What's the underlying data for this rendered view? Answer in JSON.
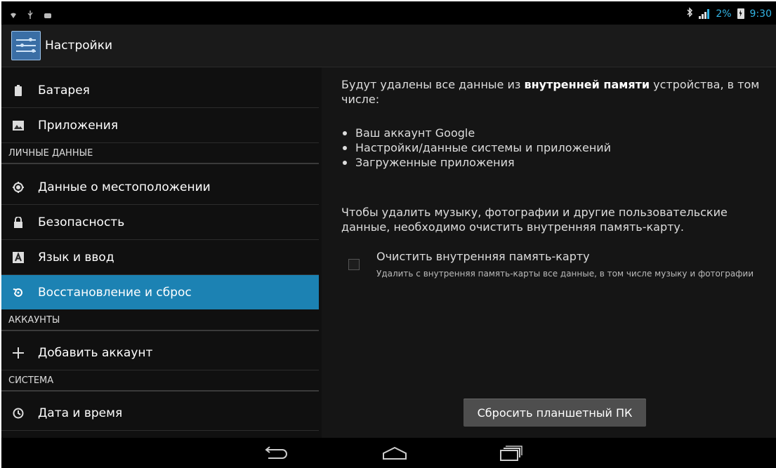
{
  "status_bar": {
    "battery_percent": "2%",
    "time": "9:30",
    "icons": [
      "wifi-icon",
      "usb-icon",
      "android-debug-icon",
      "bluetooth-icon",
      "signal-icon",
      "battery-charging-icon"
    ]
  },
  "action_bar": {
    "title": "Настройки",
    "icon": "settings-sliders-icon"
  },
  "sidebar": {
    "items": [
      {
        "label": "Батарея",
        "icon": "battery-icon"
      },
      {
        "label": "Приложения",
        "icon": "apps-image-icon"
      },
      {
        "category": "ЛИЧНЫЕ ДАННЫЕ"
      },
      {
        "label": "Данные о местоположении",
        "icon": "location-icon"
      },
      {
        "label": "Безопасность",
        "icon": "lock-icon"
      },
      {
        "label": "Язык и ввод",
        "icon": "keyboard-a-icon"
      },
      {
        "label": "Восстановление и сброс",
        "icon": "restore-icon",
        "active": true
      },
      {
        "category": "АККАУНТЫ"
      },
      {
        "label": "Добавить аккаунт",
        "icon": "plus-icon"
      },
      {
        "category": "СИСТЕМА"
      },
      {
        "label": "Дата и время",
        "icon": "clock-icon"
      }
    ]
  },
  "content": {
    "intro_prefix": "Будут удалены все данные из ",
    "intro_bold": "внутренней памяти",
    "intro_suffix": " устройства, в том числе:",
    "bullets": [
      "Ваш аккаунт Google",
      "Настройки/данные системы и приложений",
      "Загруженные приложения"
    ],
    "note": "Чтобы удалить музыку, фотографии и другие пользовательские данные, необходимо очистить внутренняя память-карту.",
    "checkbox": {
      "title": "Очистить внутренняя память-карту",
      "subtitle": "Удалить с внутренняя память-карты все данные, в том числе музыку и фотографии",
      "checked": false
    },
    "reset_button": "Сбросить планшетный ПК"
  },
  "colors": {
    "accent": "#1c82b3",
    "status_accent": "#33b5e5"
  }
}
